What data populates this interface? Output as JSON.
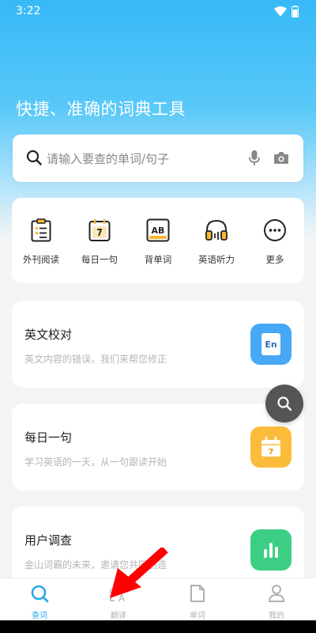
{
  "status": {
    "time": "3:22"
  },
  "hero": {
    "title": "快捷、准确的词典工具"
  },
  "search": {
    "placeholder": "请输入要查的单词/句子"
  },
  "quick_items": [
    {
      "label": "外刊阅读",
      "icon": "clipboard-icon"
    },
    {
      "label": "每日一句",
      "icon": "calendar-icon"
    },
    {
      "label": "背单词",
      "icon": "ab-card-icon"
    },
    {
      "label": "英语听力",
      "icon": "headphones-icon"
    },
    {
      "label": "更多",
      "icon": "more-icon"
    }
  ],
  "cards": [
    {
      "title": "英文校对",
      "subtitle": "英文内容的错误，我们来帮您修正",
      "icon_text": "En",
      "icon_color": "#47a8f5"
    },
    {
      "title": "每日一句",
      "subtitle": "学习英语的一天，从一句跟读开始",
      "icon_text": "7",
      "icon_color": "#fcbc3b"
    },
    {
      "title": "用户调查",
      "subtitle": "金山词霸的未来，邀请您共同创造",
      "icon_color": "#3ccf84"
    }
  ],
  "tabs": [
    {
      "label": "查词",
      "active": true
    },
    {
      "label": "翻译",
      "active": false
    },
    {
      "label": "单词",
      "active": false
    },
    {
      "label": "我的",
      "active": false
    }
  ],
  "colors": {
    "accent": "#2fa7ee",
    "arrow": "#ff0000"
  }
}
